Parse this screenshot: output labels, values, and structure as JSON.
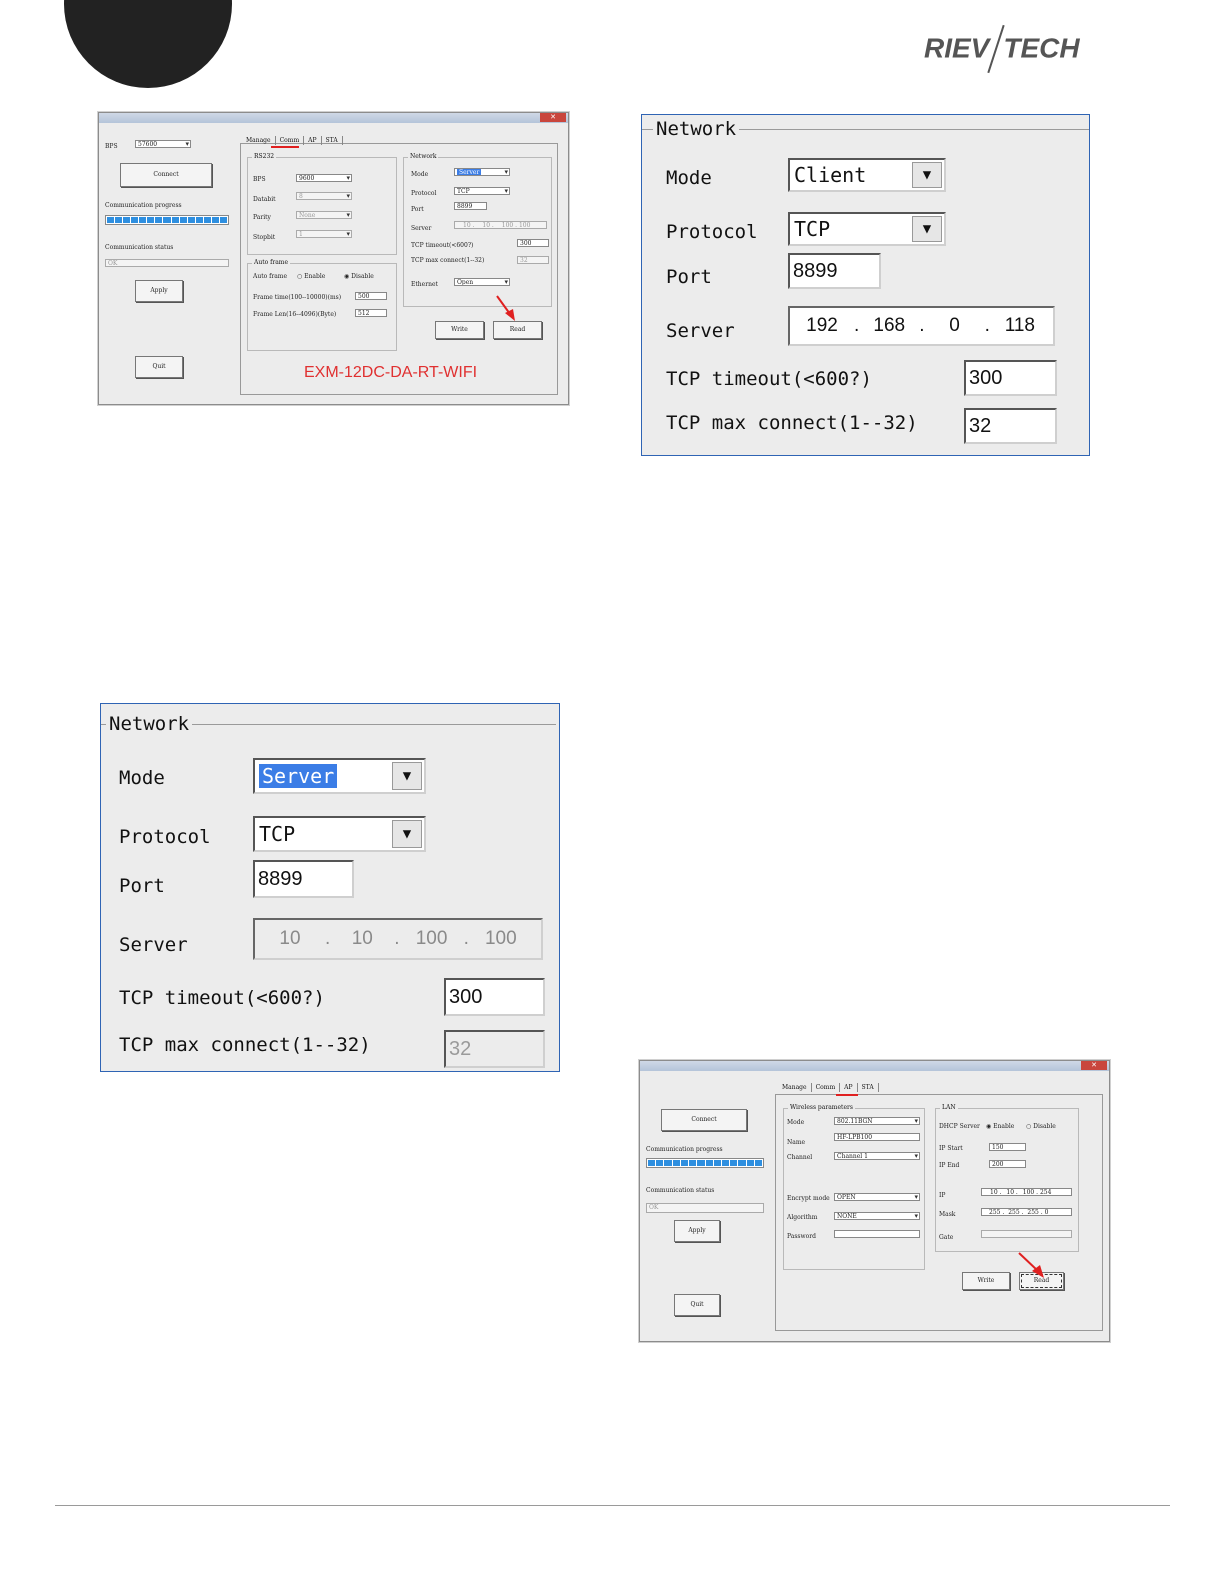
{
  "brand": {
    "logo_left": "RIEV",
    "logo_right": "TECH"
  },
  "dialog_comm": {
    "bps_label": "BPS",
    "bps_value": "57600",
    "connect_label": "Connect",
    "progress_label": "Communication progress",
    "status_label": "Communication status",
    "status_value": "OK",
    "apply_label": "Apply",
    "quit_label": "Quit",
    "tabs": [
      "Manage",
      "Comm",
      "AP",
      "STA"
    ],
    "active_tab": "Comm",
    "rs232": {
      "title": "RS232",
      "bps_label": "BPS",
      "bps_value": "9600",
      "databit_label": "Databit",
      "databit_value": "8",
      "parity_label": "Parity",
      "parity_value": "None",
      "stopbit_label": "Stopbit",
      "stopbit_value": "1"
    },
    "auto_frame": {
      "title": "Auto frame",
      "auto_label": "Auto frame",
      "enable_label": "Enable",
      "disable_label": "Disable",
      "frame_time_label": "Frame time(100--10000)(ms)",
      "frame_time_value": "500",
      "frame_len_label": "Frame Len(16--4096)(Byte)",
      "frame_len_value": "512"
    },
    "network": {
      "title": "Network",
      "mode_label": "Mode",
      "mode_value": "Server",
      "protocol_label": "Protocol",
      "protocol_value": "TCP",
      "port_label": "Port",
      "port_value": "8899",
      "server_label": "Server",
      "server_ip": [
        "10",
        "10",
        "100",
        "100"
      ],
      "timeout_label": "TCP timeout(<600?)",
      "timeout_value": "300",
      "maxconn_label": "TCP max connect(1--32)",
      "maxconn_value": "32",
      "ethernet_label": "Ethernet",
      "ethernet_value": "Open"
    },
    "write_label": "Write",
    "read_label": "Read",
    "caption": "EXM-12DC-DA-RT-WIFI"
  },
  "network_client_zoom": {
    "title": "Network",
    "mode_label": "Mode",
    "mode_value": "Client",
    "protocol_label": "Protocol",
    "protocol_value": "TCP",
    "port_label": "Port",
    "port_value": "8899",
    "server_label": "Server",
    "server_ip": [
      "192",
      "168",
      "0",
      "118"
    ],
    "timeout_label": "TCP timeout(<600?)",
    "timeout_value": "300",
    "maxconn_label": "TCP max connect(1--32)",
    "maxconn_value": "32"
  },
  "network_server_zoom": {
    "title": "Network",
    "mode_label": "Mode",
    "mode_value": "Server",
    "protocol_label": "Protocol",
    "protocol_value": "TCP",
    "port_label": "Port",
    "port_value": "8899",
    "server_label": "Server",
    "server_ip": [
      "10",
      "10",
      "100",
      "100"
    ],
    "timeout_label": "TCP timeout(<600?)",
    "timeout_value": "300",
    "maxconn_label": "TCP max connect(1--32)",
    "maxconn_value": "32"
  },
  "dialog_ap": {
    "connect_label": "Connect",
    "progress_label": "Communication progress",
    "status_label": "Communication status",
    "status_value": "OK",
    "apply_label": "Apply",
    "quit_label": "Quit",
    "tabs": [
      "Manage",
      "Comm",
      "AP",
      "STA"
    ],
    "active_tab": "AP",
    "wireless": {
      "title": "Wireless parameters",
      "mode_label": "Mode",
      "mode_value": "802.11BGN",
      "name_label": "Name",
      "name_value": "HF-LPB100",
      "channel_label": "Channel",
      "channel_value": "Channel 1",
      "encrypt_label": "Encrypt mode",
      "encrypt_value": "OPEN",
      "algorithm_label": "Algorithm",
      "algorithm_value": "NONE",
      "password_label": "Password",
      "password_value": ""
    },
    "lan": {
      "title": "LAN",
      "dhcp_label": "DHCP Server",
      "enable_label": "Enable",
      "disable_label": "Disable",
      "ip_start_label": "IP Start",
      "ip_start_value": "150",
      "ip_end_label": "IP End",
      "ip_end_value": "200",
      "ip_label": "IP",
      "ip_value": [
        "10",
        "10",
        "100",
        "254"
      ],
      "mask_label": "Mask",
      "mask_value": [
        "255",
        "255",
        "255",
        "0"
      ],
      "gate_label": "Gate"
    },
    "write_label": "Write",
    "read_label": "Read"
  },
  "colors": {
    "accent_blue": "#3b7de6",
    "progress_blue": "#2e8fe0",
    "annotation_red": "#e02020",
    "caption_red": "#e03030"
  },
  "icons": {
    "dropdown": "chevron-down-icon",
    "close": "close-icon",
    "arrow": "red-arrow-icon"
  }
}
